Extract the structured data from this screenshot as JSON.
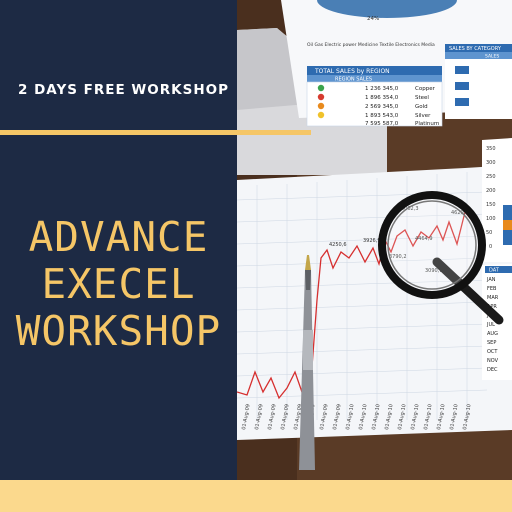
{
  "banner": {
    "subtitle": "2 DAYS FREE WORKSHOP",
    "title_lines": [
      "ADVANCE",
      "EXECEL",
      "WORKSHOP"
    ],
    "colors": {
      "navy": "#1d2a44",
      "gold": "#f5c667",
      "cream": "#fbd98d"
    }
  },
  "photo": {
    "table_header": "TOTAL SALES by REGION",
    "table_subheader": "REGION SALES",
    "table_rows": [
      {
        "value": "1 236 345,0",
        "label": "Copper"
      },
      {
        "value": "1 896 354,0",
        "label": "Steel"
      },
      {
        "value": "2 569 345,0",
        "label": "Gold"
      },
      {
        "value": "1 893 543,0",
        "label": "Silver"
      },
      {
        "value": "7 595 587,0",
        "label": "Platinum"
      }
    ],
    "side_header": "SALES BY CATEGORY",
    "side_subheader": "SALES",
    "pie_label": "24%",
    "legend": "Oil  Gas  Electric power  Medicine  Textile  Electronics  Media",
    "line_labels": [
      "8062,3",
      "4620,9",
      "4250,6",
      "4464,9",
      "3926,9",
      "3790,2",
      "3090,1"
    ],
    "y_ticks": [
      "350",
      "300",
      "250",
      "200",
      "150",
      "100",
      "50",
      "0"
    ],
    "months_header": "DAT",
    "months": [
      "JAN",
      "FEB",
      "MAR",
      "APR",
      "JUN",
      "JUL",
      "AUG",
      "SEP",
      "OCT",
      "NOV",
      "DEC"
    ],
    "x_dates": [
      "01-Aug-09",
      "01-Aug-09",
      "01-Aug-09",
      "01-Aug-09",
      "01-Aug-09",
      "01-Aug-09",
      "01-Aug-09",
      "01-Aug-09",
      "01-Aug-10",
      "01-Aug-10",
      "01-Aug-10",
      "01-Aug-10",
      "01-Aug-10",
      "01-Aug-10",
      "01-Aug-10",
      "01-Aug-10",
      "01-Aug-10",
      "01-Aug-10"
    ]
  }
}
